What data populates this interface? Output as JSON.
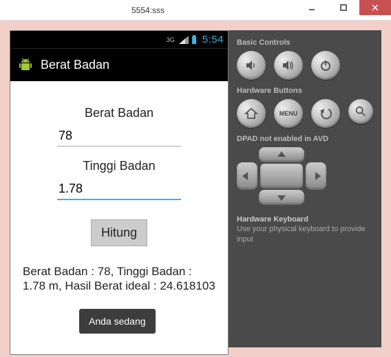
{
  "window": {
    "title": "5554:sss"
  },
  "statusbar": {
    "network": "3G",
    "clock": "5:54"
  },
  "app": {
    "title": "Berat Badan",
    "label_weight": "Berat Badan",
    "input_weight": "78",
    "label_height": "Tinggi Badan",
    "input_height": "1.78",
    "button_calc": "Hitung",
    "result": "Berat Badan : 78, Tinggi Badan : 1.78 m, Hasil Berat ideal : 24.618103",
    "toast": "Anda sedang"
  },
  "side": {
    "basic_label": "Basic Controls",
    "hw_label": "Hardware Buttons",
    "menu_text": "MENU",
    "dpad_label": "DPAD",
    "dpad_status": "not enabled in AVD",
    "kbd_label": "Hardware Keyboard",
    "kbd_note": "Use your physical keyboard to provide input"
  }
}
